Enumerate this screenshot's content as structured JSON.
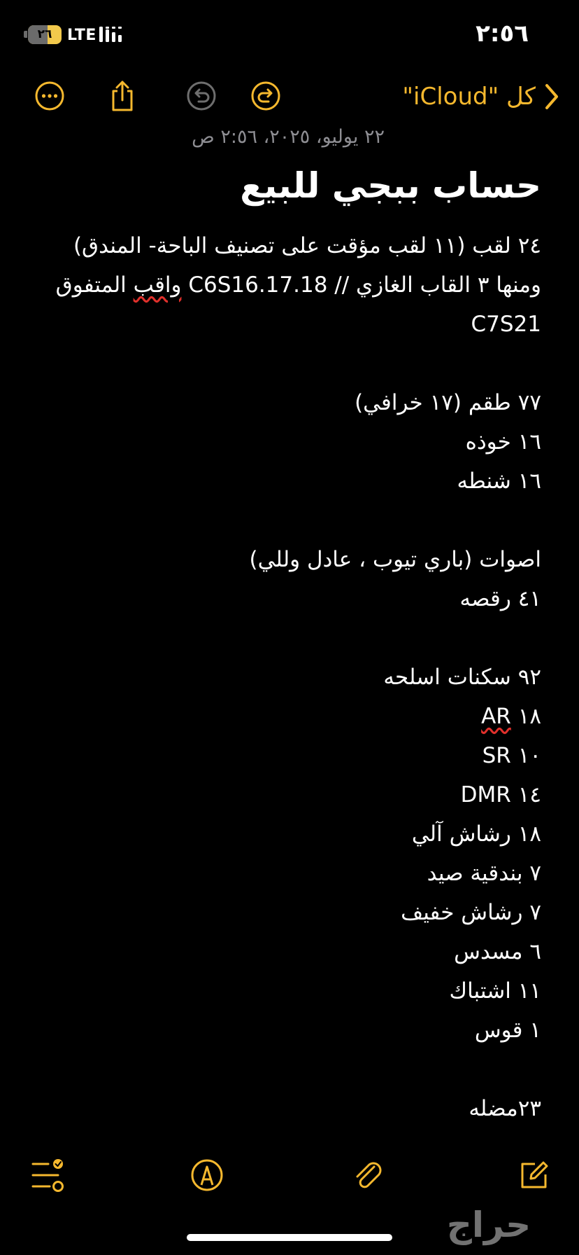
{
  "status_bar": {
    "battery_level": "٢٦",
    "network": "LTE",
    "time": "٢:٥٦"
  },
  "navbar": {
    "back_label": "كل \"iCloud\"",
    "icons": [
      "more-icon",
      "share-icon",
      "undo-icon",
      "redo-icon",
      "chevron-icon"
    ],
    "accent_color": "#f5b82e"
  },
  "note": {
    "date": "٢٢ يوليو، ٢٠٢٥، ٢:٥٦ ص",
    "title": "حساب ببجي للبيع",
    "line_1": "٢٤ لقب (١١ لقب مؤقت على تصنيف الباحة- المندق)",
    "line_2a": "ومنها ٣ القاب الغازي",
    "line_2b": "C6S16.17.18",
    "line_2c": "//",
    "line_2d": "واقب",
    "line_2e": "المتفوق",
    "line_3": "C7S21",
    "line_4": "٧٧ طقم (١٧ خرافي)",
    "line_5": "١٦ خوذه",
    "line_6": "١٦ شنطه",
    "line_7": "اصوات (باري تيوب ، عادل وللي)",
    "line_8": "٤١ رقصه",
    "line_9": "٩٢ سكنات اسلحه",
    "line_10a": "AR",
    "line_10b": "١٨",
    "line_11a": "SR",
    "line_11b": "١٠",
    "line_12a": "DMR",
    "line_12b": "١٤",
    "line_13": "١٨ رشاش آلي",
    "line_14": "٧ بندقية صيد",
    "line_15": "٧ رشاش خفيف",
    "line_16": "٦ مسدس",
    "line_17": "١١ اشتباك",
    "line_18": "١ قوس",
    "line_19": "٢٣مضله"
  },
  "toolbar": {
    "icons": [
      "compose-icon",
      "markup-icon",
      "attachment-icon",
      "checklist-icon"
    ]
  },
  "watermark": "حراج"
}
